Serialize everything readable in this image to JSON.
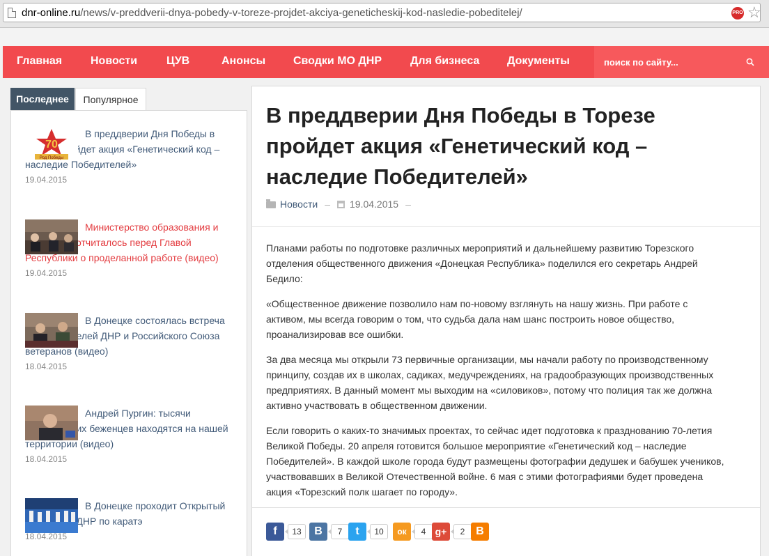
{
  "browser": {
    "url_host": "dnr-online.ru",
    "url_path": "/news/v-preddverii-dnya-pobedy-v-toreze-projdet-akciya-geneticheskij-kod-nasledie-pobeditelej/",
    "pro_badge": "PRO"
  },
  "nav": {
    "items": [
      {
        "label": "Главная"
      },
      {
        "label": "Новости"
      },
      {
        "label": "ЦУВ"
      },
      {
        "label": "Анонсы"
      },
      {
        "label": "Сводки МО ДНР"
      },
      {
        "label": "Для бизнеса"
      },
      {
        "label": "Документы"
      }
    ],
    "search_placeholder": "поиск по сайту..."
  },
  "sidebar": {
    "tabs": {
      "latest": "Последнее",
      "popular": "Популярное"
    },
    "items": [
      {
        "title": "В преддверии Дня Победы в Торезе пройдет акция «Генетический код – наследие Победителей»",
        "date": "19.04.2015"
      },
      {
        "title": "Министерство образования и науки ДНР отчиталось перед Главой Республики о проделанной работе (видео)",
        "date": "19.04.2015"
      },
      {
        "title": "В Донецке состоялась встреча представителей ДНР и Российского Союза ветеранов (видео)",
        "date": "18.04.2015"
      },
      {
        "title": "Андрей Пургин: тысячи политических беженцев находятся на нашей территории (видео)",
        "date": "18.04.2015"
      },
      {
        "title": "В Донецке проходит Открытый чемпионат ДНР по каратэ",
        "date": "18.04.2015"
      }
    ],
    "thumb_texts": {
      "badge_number": "70",
      "badge_caption": "Род Победы"
    }
  },
  "article": {
    "title": "В преддверии Дня Победы в Торезе пройдет акция «Генетический код – наследие Победителей»",
    "category": "Новости",
    "date": "19.04.2015",
    "paragraphs": [
      "Планами работы по подготовке различных мероприятий и дальнейшему развитию Торезского отделения общественного движения «Донецкая Республика» поделился его секретарь Андрей Бедило:",
      "«Общественное движение позволило нам по-новому взглянуть на нашу жизнь. При работе с активом, мы всегда говорим о том, что судьба дала нам шанс построить новое общество, проанализировав все ошибки.",
      "За два месяца мы открыли 73 первичные организации, мы начали работу по производственному принципу, создав их в школах, садиках, медучреждениях, на градообразующих производственных предприятиях. В данный момент мы выходим на «силовиков», потому что полиция так же должна активно участвовать в общественном движении.",
      "Если говорить о каких-то значимых проектах, то сейчас идет подготовка к празднованию 70-летия Великой Победы. 20 апреля готовится большое мероприятие «Генетический код – наследие Победителей». В каждой школе города будут размещены фотографии дедушек и бабушек учеников, участвовавших в Великой Отечественной войне. 6 мая с этими фотографиями будет проведена акция «Торезский полк шагает по городу»."
    ]
  },
  "share": [
    {
      "network": "facebook",
      "glyph": "f",
      "count": "13",
      "color": "#3b5998"
    },
    {
      "network": "vkontakte",
      "glyph": "B",
      "count": "7",
      "color": "#4c75a3"
    },
    {
      "network": "twitter",
      "glyph": "t",
      "count": "10",
      "color": "#2aa3ef"
    },
    {
      "network": "odnoklassniki",
      "glyph": "ок",
      "count": "4",
      "color": "#f59a21"
    },
    {
      "network": "google-plus",
      "glyph": "g+",
      "count": "2",
      "color": "#dd4b39"
    },
    {
      "network": "blogger",
      "glyph": "B",
      "count": "",
      "color": "#f57d00"
    }
  ],
  "colors": {
    "nav_bg": "#f24a4e",
    "tab_active": "#425566",
    "link": "#425b79",
    "link_active": "#e33c40"
  }
}
